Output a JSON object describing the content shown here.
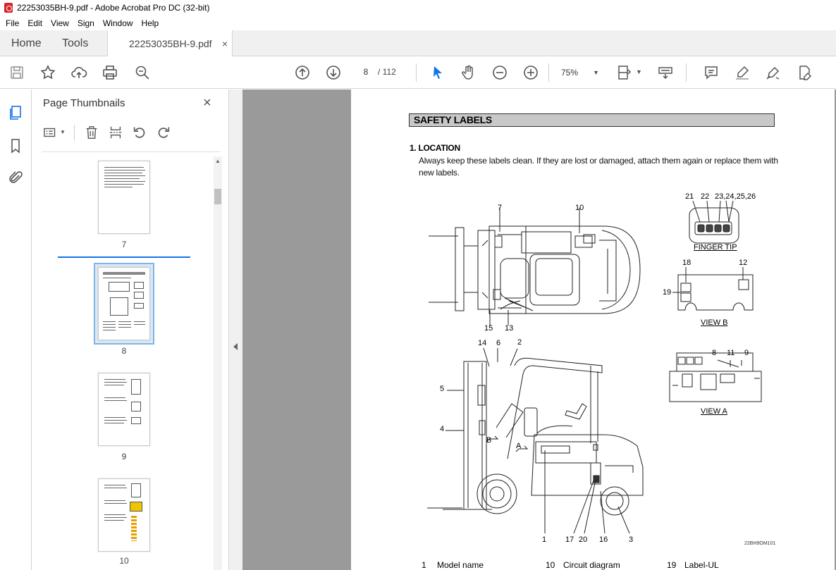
{
  "window": {
    "title": "22253035BH-9.pdf - Adobe Acrobat Pro DC (32-bit)"
  },
  "menu": [
    "File",
    "Edit",
    "View",
    "Sign",
    "Window",
    "Help"
  ],
  "tabs": {
    "home": "Home",
    "tools": "Tools",
    "document": "22253035BH-9.pdf",
    "close": "×"
  },
  "toolbar": {
    "current_page": "8",
    "total_pages": "/ 112",
    "zoom": "75%"
  },
  "thumbnails": {
    "title": "Page Thumbnails",
    "close": "×",
    "pages": [
      "7",
      "8",
      "9",
      "10"
    ],
    "selected": "8"
  },
  "document": {
    "section_title": "SAFETY LABELS",
    "location_heading": "1. LOCATION",
    "location_text": "Always keep these labels clean.  If they are lost or damaged, attach them again or replace them with new labels.",
    "captions": {
      "finger_tip": "FINGER TIP",
      "view_b": "VIEW B",
      "view_a": "VIEW A"
    },
    "figure_code": "22BH9OM101",
    "callouts": {
      "c7": "7",
      "c10": "10",
      "c15": "15",
      "c13": "13",
      "c21": "21",
      "c22": "22",
      "c23": "23,24,25,26",
      "c18": "18",
      "c12": "12",
      "c19": "19",
      "c14": "14",
      "c6": "6",
      "c2": "2",
      "c5": "5",
      "c4": "4",
      "cB": "B",
      "cA": "A",
      "c8": "8",
      "c11": "11",
      "c9": "9",
      "c1": "1",
      "c17": "17",
      "c20": "20",
      "c16": "16",
      "c3": "3"
    },
    "legend": [
      {
        "num": "1",
        "name": "Model name"
      },
      {
        "num": "10",
        "name": "Circuit diagram"
      },
      {
        "num": "19",
        "name": "Label-UL"
      }
    ]
  }
}
